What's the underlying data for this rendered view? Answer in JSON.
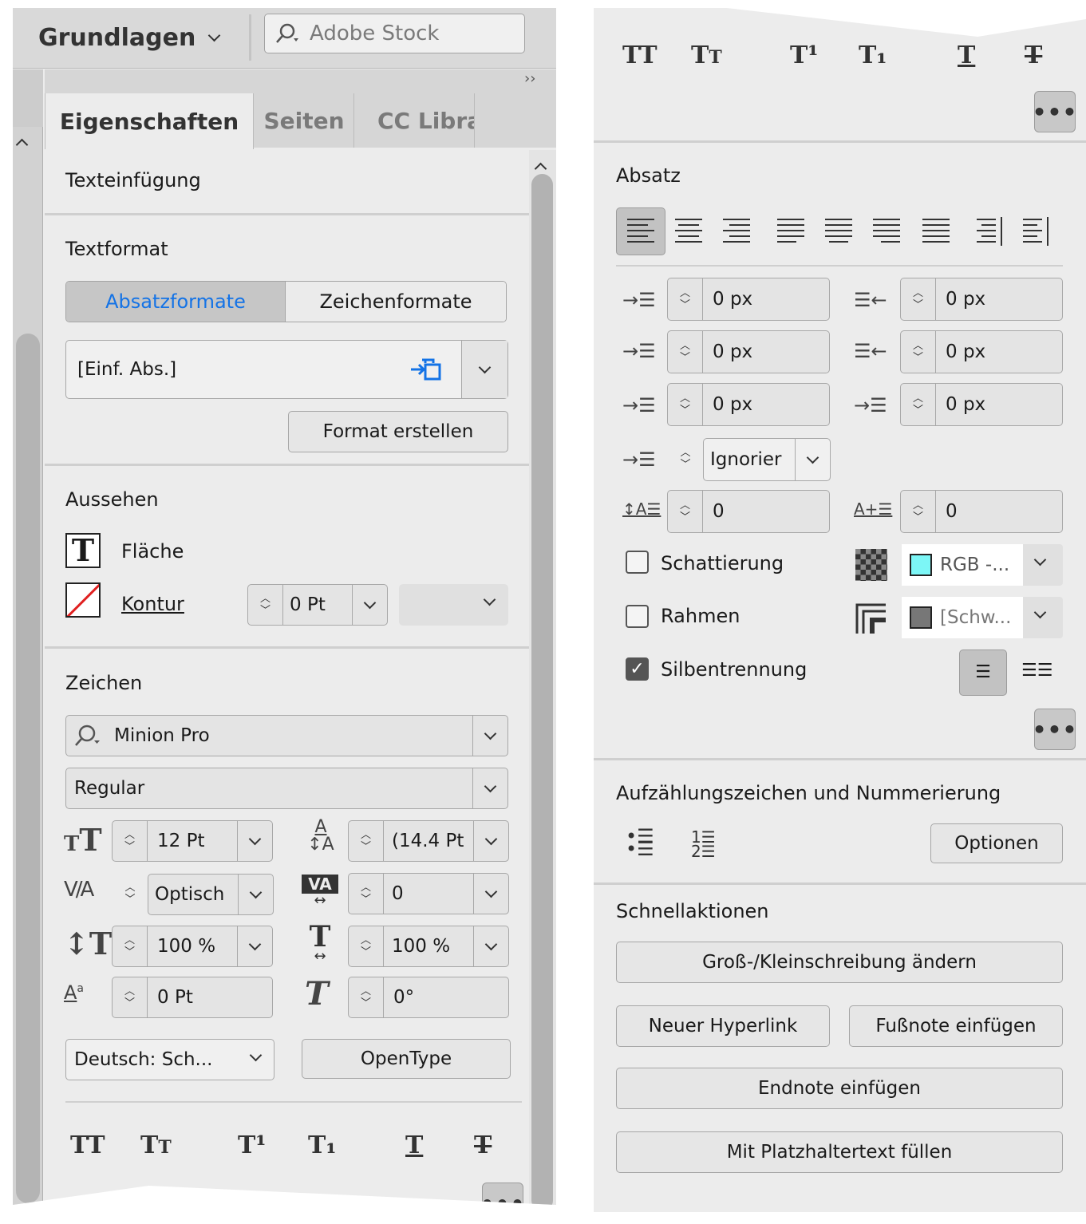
{
  "workspace": {
    "label": "Grundlagen"
  },
  "stock_search": {
    "placeholder": "Adobe Stock"
  },
  "panel_collapse": "››",
  "tabs": [
    {
      "label": "Eigenschaften"
    },
    {
      "label": "Seiten"
    },
    {
      "label": "CC Libra"
    }
  ],
  "text_insertion": {
    "title": "Texteinfügung"
  },
  "text_format": {
    "title": "Textformat",
    "toggle": [
      "Absatzformate",
      "Zeichenformate"
    ],
    "style_value": "[Einf. Abs.]",
    "create_label": "Format erstellen"
  },
  "appearance": {
    "title": "Aussehen",
    "fill_label": "Fläche",
    "stroke_label": "Kontur",
    "stroke_weight": "0 Pt"
  },
  "character": {
    "title": "Zeichen",
    "font_family": "Minion Pro",
    "font_style": "Regular",
    "size": "12 Pt",
    "leading": "(14.4 Pt",
    "kerning": "Optisch",
    "tracking": "0",
    "vscale": "100 %",
    "hscale": "100 %",
    "baseline": "0 Pt",
    "skew": "0°",
    "language": "Deutsch: Sch...",
    "opentype_label": "OpenType"
  },
  "char_styles": [
    "TT",
    "Tt",
    "T¹",
    "T₁",
    "T",
    "T"
  ],
  "paragraph": {
    "title": "Absatz",
    "left_indent": "0 px",
    "right_indent": "0 px",
    "first_line_indent": "0 px",
    "last_line_indent": "0 px",
    "space_before": "0 px",
    "space_after": "0 px",
    "grid_align": "Ignorier",
    "drop_cap_lines": "0",
    "drop_cap_chars": "0",
    "shading_label": "Schattierung",
    "shading_color": "RGB -...",
    "border_label": "Rahmen",
    "border_color": "[Schw...",
    "hyphen_label": "Silbentrennung"
  },
  "bullets": {
    "title": "Aufzählungszeichen und Nummerierung",
    "options_label": "Optionen"
  },
  "quick": {
    "title": "Schnellaktionen",
    "change_case": "Groß-/Kleinschreibung ändern",
    "hyperlink": "Neuer Hyperlink",
    "footnote": "Fußnote einfügen",
    "endnote": "Endnote einfügen",
    "placeholder": "Mit Platzhaltertext füllen"
  },
  "more_icon": "•••",
  "colors": {
    "panel": "#ececec",
    "accent": "#1473e6",
    "shading_swatch": "#7cf6f6",
    "border_swatch": "#777777"
  }
}
